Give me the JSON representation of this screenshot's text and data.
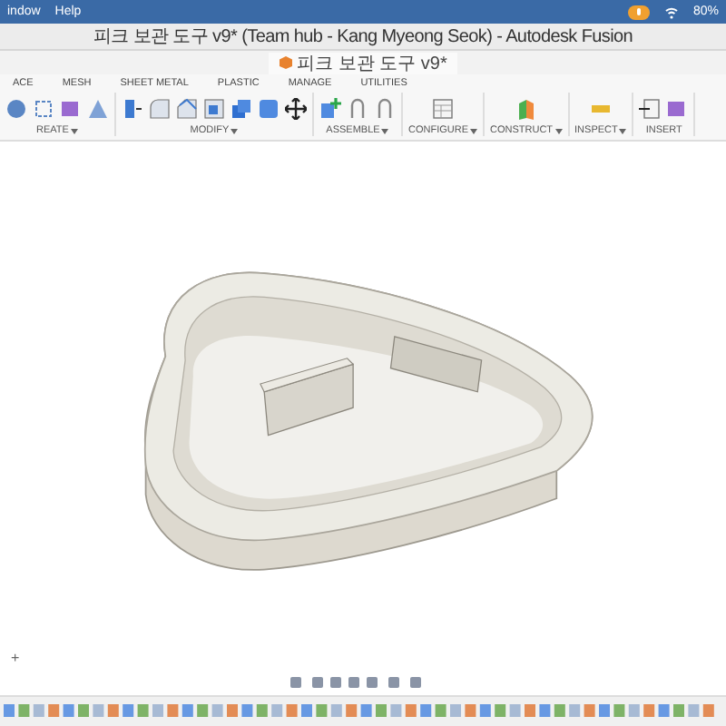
{
  "menubar": {
    "items": [
      "indow",
      "Help"
    ],
    "battery": "80%"
  },
  "window": {
    "title": "피크 보관 도구 v9* (Team hub - Kang Myeong Seok) - Autodesk Fusion"
  },
  "document_tab": {
    "label": "피크 보관 도구 v9*"
  },
  "toolbar": {
    "tabs": [
      "ACE",
      "MESH",
      "SHEET METAL",
      "PLASTIC",
      "MANAGE",
      "UTILITIES"
    ],
    "groups": [
      {
        "label": "REATE",
        "dropdown": true,
        "tools": [
          {
            "kind": "sphere"
          },
          {
            "kind": "sketch"
          },
          {
            "kind": "box"
          },
          {
            "kind": "cone"
          }
        ]
      },
      {
        "label": "MODIFY",
        "dropdown": true,
        "tools": [
          {
            "kind": "press"
          },
          {
            "kind": "fillet"
          },
          {
            "kind": "chamfer"
          },
          {
            "kind": "shell"
          },
          {
            "kind": "combine"
          },
          {
            "kind": "scale"
          },
          {
            "kind": "move"
          }
        ]
      },
      {
        "label": "ASSEMBLE",
        "dropdown": true,
        "tools": [
          {
            "kind": "component"
          },
          {
            "kind": "joint"
          },
          {
            "kind": "joint"
          }
        ]
      },
      {
        "label": "CONFIGURE",
        "dropdown": true,
        "tools": [
          {
            "kind": "table"
          }
        ]
      },
      {
        "label": "CONSTRUCT",
        "dropdown": true,
        "tools": [
          {
            "kind": "plane"
          }
        ]
      },
      {
        "label": "INSPECT",
        "dropdown": true,
        "tools": [
          {
            "kind": "measure"
          }
        ]
      },
      {
        "label": "INSERT",
        "dropdown": false,
        "tools": [
          {
            "kind": "insert"
          },
          {
            "kind": "box"
          }
        ]
      }
    ]
  },
  "viewport": {
    "add_button": "+"
  }
}
